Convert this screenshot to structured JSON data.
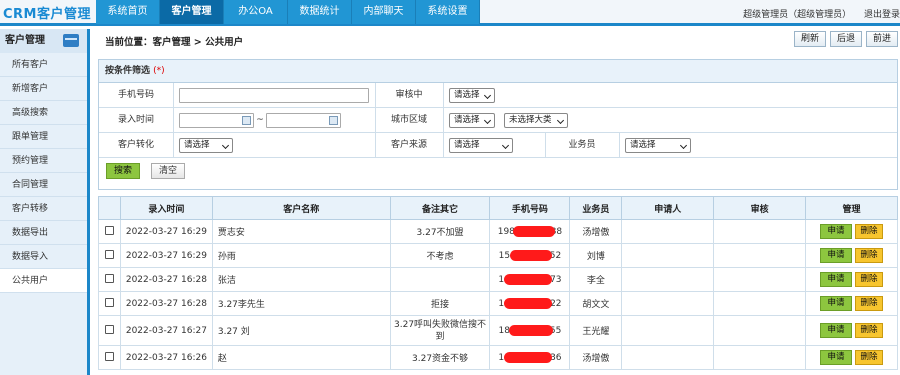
{
  "app": {
    "logo": "CRM客户管理"
  },
  "nav": {
    "items": [
      "系统首页",
      "客户管理",
      "办公OA",
      "数据统计",
      "内部聊天",
      "系统设置"
    ],
    "active": 1
  },
  "user": {
    "name": "超级管理员（超级管理员）",
    "logout": "退出登录"
  },
  "sidebar": {
    "title": "客户管理",
    "items": [
      "所有客户",
      "新增客户",
      "高级搜索",
      "跟单管理",
      "预约管理",
      "合同管理",
      "客户转移",
      "数据导出",
      "数据导入",
      "公共用户"
    ],
    "active": 9
  },
  "breadcrumb": {
    "text": "当前位置：客户管理 > 公共用户"
  },
  "toolbar": {
    "refresh": "刷新",
    "back": "后退",
    "forward": "前进"
  },
  "filter": {
    "title": "按条件筛选",
    "required_mark": "(*)",
    "phone_label": "手机号码",
    "audit_label": "审核中",
    "audit_value": "请选择",
    "date_label": "录入时间",
    "date_sep": "~",
    "region_label": "城市区域",
    "region_value": "请选择",
    "category_value": "未选择大类",
    "convert_label": "客户转化",
    "convert_value": "请选择",
    "source_label": "客户来源",
    "source_value": "请选择",
    "staff_label": "业务员",
    "staff_value": "请选择",
    "search_btn": "搜索",
    "clear_btn": "清空"
  },
  "table": {
    "headers": [
      "",
      "录入时间",
      "客户名称",
      "备注其它",
      "手机号码",
      "业务员",
      "申请人",
      "审核",
      "管理"
    ],
    "apply_label": "申请",
    "delete_label": "删除",
    "rows": [
      {
        "time": "2022-03-27 16:29",
        "name": "贾志安",
        "note": "3.27不加盟",
        "phone_pre": "1980",
        "phone_post": "88",
        "staff": "汤增傲",
        "applicant": "",
        "audit": ""
      },
      {
        "time": "2022-03-27 16:29",
        "name": "孙雨",
        "note": "不考虑",
        "phone_pre": "15",
        "phone_post": "252",
        "staff": "刘博",
        "applicant": "",
        "audit": ""
      },
      {
        "time": "2022-03-27 16:28",
        "name": "张洁",
        "note": "",
        "phone_pre": "1",
        "phone_post": "73",
        "staff": "李全",
        "applicant": "",
        "audit": ""
      },
      {
        "time": "2022-03-27 16:28",
        "name": "3.27李先生",
        "note": "拒接",
        "phone_pre": "1",
        "phone_post": "22",
        "staff": "胡文文",
        "applicant": "",
        "audit": ""
      },
      {
        "time": "2022-03-27 16:27",
        "name": "3.27 刘",
        "note": "3.27呼叫失败微信搜不到",
        "phone_pre": "18",
        "phone_post": "55",
        "staff": "王光耀",
        "applicant": "",
        "audit": ""
      },
      {
        "time": "2022-03-27 16:26",
        "name": "赵",
        "note": "3.27资金不够",
        "phone_pre": "1",
        "phone_post": "36",
        "staff": "汤增傲",
        "applicant": "",
        "audit": ""
      }
    ]
  },
  "colors": {
    "brand": "#1c87c9",
    "nav_bg": "#2196d4",
    "nav_active": "#0b6aa6",
    "apply": "#8dc63f",
    "delete": "#f7c52e",
    "redaction": "#ff1a1a"
  }
}
